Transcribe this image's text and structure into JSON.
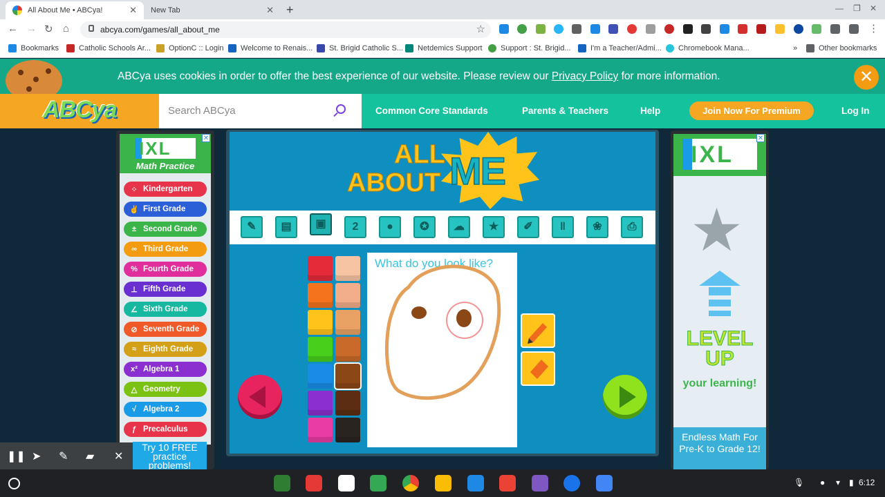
{
  "browser": {
    "tabs": [
      {
        "title": "All About Me • ABCya!",
        "active": true
      },
      {
        "title": "New Tab",
        "active": false
      }
    ],
    "url": "abcya.com/games/all_about_me",
    "bookmarks": [
      "Bookmarks",
      "Catholic Schools Ar...",
      "OptionC :: Login",
      "Welcome to Renais...",
      "St. Brigid Catholic S...",
      "Netdemics Support",
      "Support : St. Brigid...",
      "I'm a Teacher/Admi...",
      "Chromebook Mana..."
    ],
    "other_bookmarks": "Other bookmarks",
    "more_bookmarks": "»"
  },
  "cookie": {
    "text_before": "ABCya uses cookies in order to offer the best experience of our website. Please review our ",
    "link": "Privacy Policy",
    "text_after": " for more information.",
    "close_symbol": "✕"
  },
  "header": {
    "logo": "ABCya",
    "search_placeholder": "Search ABCya",
    "nav": [
      "Common Core Standards",
      "Parents & Teachers",
      "Help"
    ],
    "premium": "Join Now For Premium",
    "login": "Log In"
  },
  "ad_left": {
    "brand": "IXL",
    "subtitle": "Math Practice",
    "grades": [
      {
        "icon": "⁘",
        "label": "Kindergarten",
        "color": "#e8344a"
      },
      {
        "icon": "✌",
        "label": "First Grade",
        "color": "#2a5fd8"
      },
      {
        "icon": "±",
        "label": "Second Grade",
        "color": "#3bb54a"
      },
      {
        "icon": "∞",
        "label": "Third Grade",
        "color": "#f39c12"
      },
      {
        "icon": "%",
        "label": "Fourth Grade",
        "color": "#e02f9c"
      },
      {
        "icon": "⊥",
        "label": "Fifth Grade",
        "color": "#6a2fd0"
      },
      {
        "icon": "∠",
        "label": "Sixth Grade",
        "color": "#17b8a0"
      },
      {
        "icon": "⊘",
        "label": "Seventh Grade",
        "color": "#f05a28"
      },
      {
        "icon": "≈",
        "label": "Eighth Grade",
        "color": "#d4a017"
      },
      {
        "icon": "x²",
        "label": "Algebra 1",
        "color": "#8b2fd0"
      },
      {
        "icon": "△",
        "label": "Geometry",
        "color": "#7cc215"
      },
      {
        "icon": "√",
        "label": "Algebra 2",
        "color": "#1a9be8"
      },
      {
        "icon": "ƒ",
        "label": "Precalculus",
        "color": "#e8344a"
      }
    ],
    "bottom_text": "Try 10 FREE practice problems!"
  },
  "ad_right": {
    "brand": "IXL",
    "headline": "LEVEL UP",
    "sub": "your learning!",
    "bottom": "Endless Math For Pre-K to Grade 12!"
  },
  "game": {
    "title_all": "ALL",
    "title_about": "ABOUT",
    "title_me": "ME",
    "tools": [
      "pencil",
      "stack",
      "portrait",
      "two",
      "apple",
      "ribbon",
      "cloud",
      "star",
      "pencil-2",
      "utensils",
      "paw",
      "printer"
    ],
    "prompt": "What do you look like?",
    "palette": [
      [
        "#e52b3a",
        "#f7c4a3"
      ],
      [
        "#f5731d",
        "#f2ad8a"
      ],
      [
        "#ffc31a",
        "#e9a263"
      ],
      [
        "#47cf1c",
        "#c96a2a"
      ],
      [
        "#1a8ce8",
        "#8c4717"
      ],
      [
        "#8b2fd0",
        "#5c2d12"
      ],
      [
        "#e93ca4",
        "#2a2420"
      ]
    ],
    "selected_swatch": "#8c4717"
  },
  "annotation_tools": [
    "pause",
    "pointer",
    "pen",
    "highlighter",
    "close"
  ],
  "taskbar": {
    "time": "6:12",
    "apps": [
      "classroom",
      "youtube",
      "calendar",
      "play-store",
      "chrome",
      "slides-photo",
      "drive",
      "gmail",
      "forms",
      "files",
      "docs"
    ]
  }
}
